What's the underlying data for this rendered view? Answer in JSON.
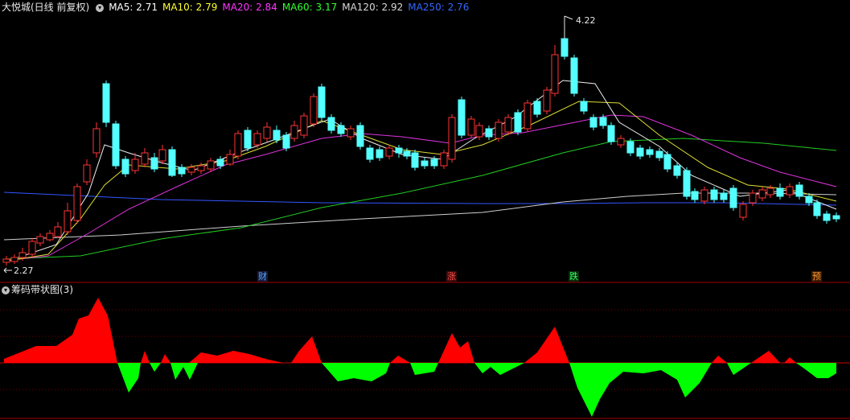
{
  "header": {
    "title": "大悦城(日线 前复权)",
    "mas": [
      {
        "label": "MA5: 2.71",
        "color": "#ffffff"
      },
      {
        "label": "MA10: 2.79",
        "color": "#ffff33"
      },
      {
        "label": "MA20: 2.84",
        "color": "#ff33ff"
      },
      {
        "label": "MA60: 3.17",
        "color": "#33ff33"
      },
      {
        "label": "MA120: 2.92",
        "color": "#d8d8d8"
      },
      {
        "label": "MA250: 2.76",
        "color": "#3366ff"
      }
    ]
  },
  "price_panel": {
    "max_label": "4.22",
    "min_label": "2.27",
    "events": [
      {
        "label": "财",
        "color": "#4da6ff"
      },
      {
        "label": "涨",
        "color": "#ff4d4d"
      },
      {
        "label": "跌",
        "color": "#33ff66"
      },
      {
        "label": "预",
        "color": "#ff9933"
      }
    ]
  },
  "indicator_panel": {
    "title": "筹码带状图(3)"
  },
  "colors": {
    "up": "#ff3333",
    "down": "#54ffff",
    "pos_area": "#ff0000",
    "neg_area": "#00ff00",
    "grid": "#7a0000"
  }
}
